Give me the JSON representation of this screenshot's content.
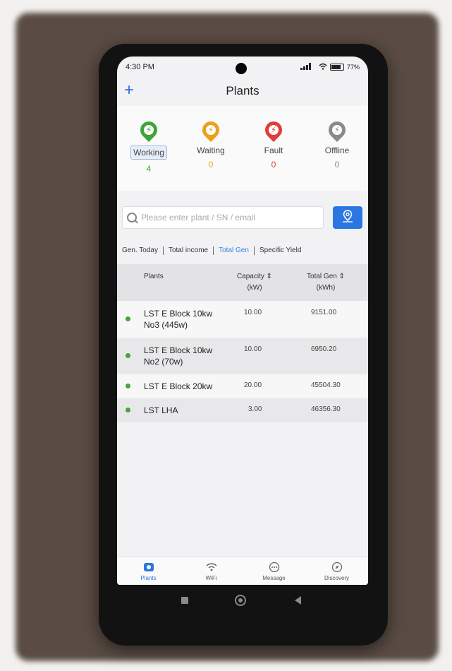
{
  "status_bar": {
    "time": "4:30 PM",
    "battery": "77%"
  },
  "header": {
    "add_label": "+",
    "title": "Plants"
  },
  "summary": {
    "items": [
      {
        "label": "Working",
        "count": "4",
        "color": "#3ea53a"
      },
      {
        "label": "Waiting",
        "count": "0",
        "color": "#e8a21c"
      },
      {
        "label": "Fault",
        "count": "0",
        "color": "#e23b3b"
      },
      {
        "label": "Offline",
        "count": "0",
        "color": "#8a8a8a"
      }
    ]
  },
  "search": {
    "placeholder": "Please enter plant / SN / email"
  },
  "sort_tabs": [
    "Gen. Today",
    "Total income",
    "Total Gen",
    "Specific Yield"
  ],
  "table": {
    "headers": {
      "plants": "Plants",
      "capacity": "Capacity ⇕",
      "capacity_unit": "(kW)",
      "total_gen": "Total Gen ⇕",
      "total_gen_unit": "(kWh)"
    },
    "rows": [
      {
        "name": "LST E Block 10kw No3 (445w)",
        "capacity": "10.00",
        "total_gen": "9151.00"
      },
      {
        "name": "LST E Block 10kw No2 (70w)",
        "capacity": "10.00",
        "total_gen": "6950.20"
      },
      {
        "name": "LST E Block 20kw",
        "capacity": "20.00",
        "total_gen": "45504.30"
      },
      {
        "name": "LST LHA",
        "capacity": "3.00",
        "total_gen": "46356.30"
      }
    ]
  },
  "tab_bar": {
    "items": [
      "Plants",
      "WiFi",
      "Message",
      "Discovery"
    ]
  },
  "colors": {
    "accent": "#2a76e2",
    "online_dot": "#47a33a"
  }
}
